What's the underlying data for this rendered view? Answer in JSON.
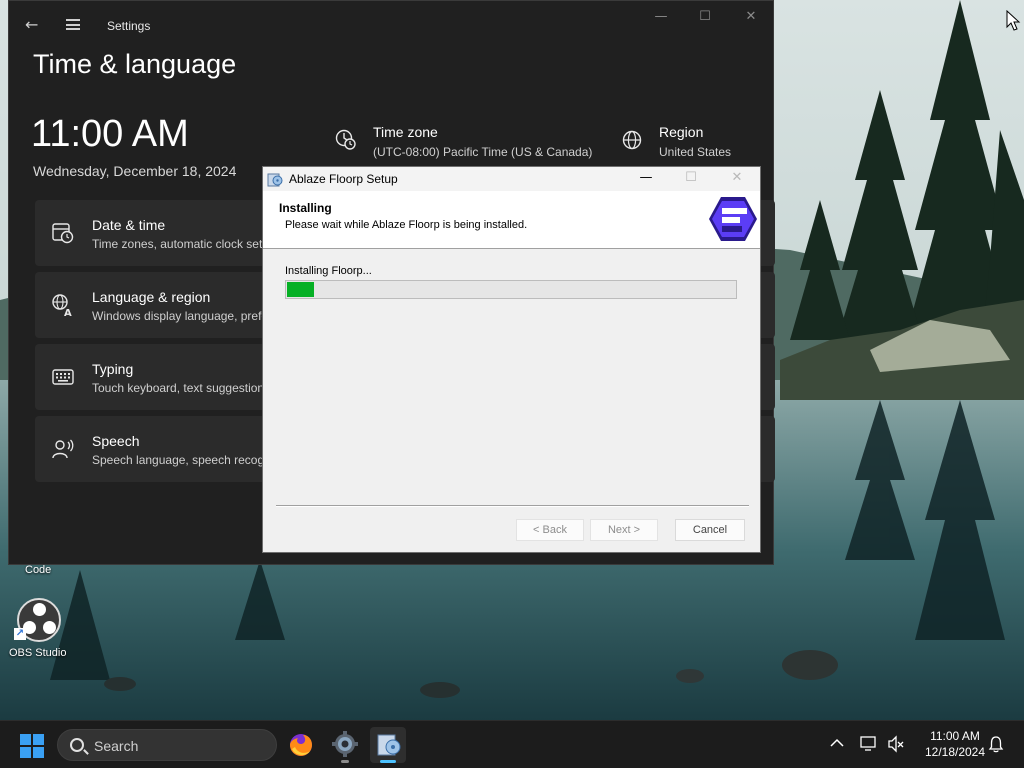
{
  "desktop": {
    "icons": [
      {
        "label": "Code"
      },
      {
        "label": "OBS Studio"
      }
    ]
  },
  "settings_window": {
    "app_title": "Settings",
    "page_title": "Time & language",
    "clock": "11:00 AM",
    "date": "Wednesday, December 18, 2024",
    "time_zone": {
      "title": "Time zone",
      "value": "(UTC-08:00) Pacific Time (US & Canada)"
    },
    "region": {
      "title": "Region",
      "value": "United States"
    },
    "cards": [
      {
        "title": "Date & time",
        "subtitle": "Time zones, automatic clock settings, calendar display",
        "icon": "clock-calendar-icon"
      },
      {
        "title": "Language & region",
        "subtitle": "Windows display language, preferred languages, regional format",
        "icon": "language-icon"
      },
      {
        "title": "Typing",
        "subtitle": "Touch keyboard, text suggestions, preferences",
        "icon": "keyboard-icon"
      },
      {
        "title": "Speech",
        "subtitle": "Speech language, speech recognition microphone setup, voices",
        "icon": "speech-icon"
      }
    ]
  },
  "setup_dialog": {
    "title": "Ablaze Floorp Setup",
    "header_title": "Installing",
    "header_subtitle": "Please wait while Ablaze Floorp is being installed.",
    "status": "Installing Floorp...",
    "progress": 0.06,
    "progress_color": "#06b025",
    "buttons": {
      "back": "< Back",
      "next": "Next >",
      "cancel": "Cancel"
    }
  },
  "taskbar": {
    "search_placeholder": "Search",
    "apps": [
      "firefox-icon",
      "settings-gear-icon",
      "installer-icon"
    ],
    "time": "11:00 AM",
    "date": "12/18/2024",
    "accent": "#4cc2ff"
  }
}
